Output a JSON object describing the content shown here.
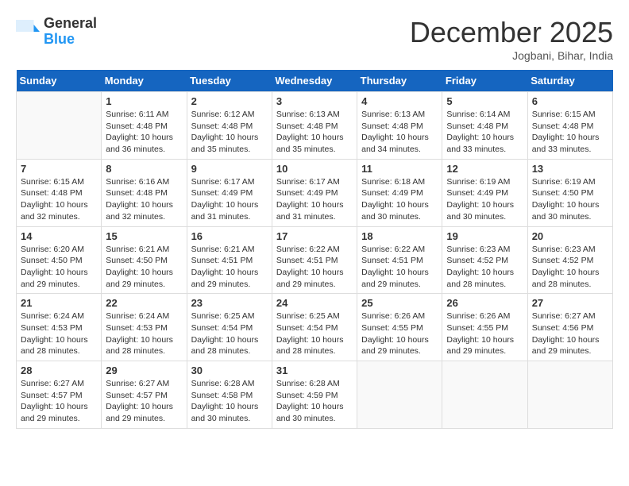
{
  "header": {
    "logo_general": "General",
    "logo_blue": "Blue",
    "month_title": "December 2025",
    "location": "Jogbani, Bihar, India"
  },
  "calendar": {
    "days_of_week": [
      "Sunday",
      "Monday",
      "Tuesday",
      "Wednesday",
      "Thursday",
      "Friday",
      "Saturday"
    ],
    "weeks": [
      [
        {
          "day": "",
          "info": ""
        },
        {
          "day": "1",
          "info": "Sunrise: 6:11 AM\nSunset: 4:48 PM\nDaylight: 10 hours and 36 minutes."
        },
        {
          "day": "2",
          "info": "Sunrise: 6:12 AM\nSunset: 4:48 PM\nDaylight: 10 hours and 35 minutes."
        },
        {
          "day": "3",
          "info": "Sunrise: 6:13 AM\nSunset: 4:48 PM\nDaylight: 10 hours and 35 minutes."
        },
        {
          "day": "4",
          "info": "Sunrise: 6:13 AM\nSunset: 4:48 PM\nDaylight: 10 hours and 34 minutes."
        },
        {
          "day": "5",
          "info": "Sunrise: 6:14 AM\nSunset: 4:48 PM\nDaylight: 10 hours and 33 minutes."
        },
        {
          "day": "6",
          "info": "Sunrise: 6:15 AM\nSunset: 4:48 PM\nDaylight: 10 hours and 33 minutes."
        }
      ],
      [
        {
          "day": "7",
          "info": "Sunrise: 6:15 AM\nSunset: 4:48 PM\nDaylight: 10 hours and 32 minutes."
        },
        {
          "day": "8",
          "info": "Sunrise: 6:16 AM\nSunset: 4:48 PM\nDaylight: 10 hours and 32 minutes."
        },
        {
          "day": "9",
          "info": "Sunrise: 6:17 AM\nSunset: 4:49 PM\nDaylight: 10 hours and 31 minutes."
        },
        {
          "day": "10",
          "info": "Sunrise: 6:17 AM\nSunset: 4:49 PM\nDaylight: 10 hours and 31 minutes."
        },
        {
          "day": "11",
          "info": "Sunrise: 6:18 AM\nSunset: 4:49 PM\nDaylight: 10 hours and 30 minutes."
        },
        {
          "day": "12",
          "info": "Sunrise: 6:19 AM\nSunset: 4:49 PM\nDaylight: 10 hours and 30 minutes."
        },
        {
          "day": "13",
          "info": "Sunrise: 6:19 AM\nSunset: 4:50 PM\nDaylight: 10 hours and 30 minutes."
        }
      ],
      [
        {
          "day": "14",
          "info": "Sunrise: 6:20 AM\nSunset: 4:50 PM\nDaylight: 10 hours and 29 minutes."
        },
        {
          "day": "15",
          "info": "Sunrise: 6:21 AM\nSunset: 4:50 PM\nDaylight: 10 hours and 29 minutes."
        },
        {
          "day": "16",
          "info": "Sunrise: 6:21 AM\nSunset: 4:51 PM\nDaylight: 10 hours and 29 minutes."
        },
        {
          "day": "17",
          "info": "Sunrise: 6:22 AM\nSunset: 4:51 PM\nDaylight: 10 hours and 29 minutes."
        },
        {
          "day": "18",
          "info": "Sunrise: 6:22 AM\nSunset: 4:51 PM\nDaylight: 10 hours and 29 minutes."
        },
        {
          "day": "19",
          "info": "Sunrise: 6:23 AM\nSunset: 4:52 PM\nDaylight: 10 hours and 28 minutes."
        },
        {
          "day": "20",
          "info": "Sunrise: 6:23 AM\nSunset: 4:52 PM\nDaylight: 10 hours and 28 minutes."
        }
      ],
      [
        {
          "day": "21",
          "info": "Sunrise: 6:24 AM\nSunset: 4:53 PM\nDaylight: 10 hours and 28 minutes."
        },
        {
          "day": "22",
          "info": "Sunrise: 6:24 AM\nSunset: 4:53 PM\nDaylight: 10 hours and 28 minutes."
        },
        {
          "day": "23",
          "info": "Sunrise: 6:25 AM\nSunset: 4:54 PM\nDaylight: 10 hours and 28 minutes."
        },
        {
          "day": "24",
          "info": "Sunrise: 6:25 AM\nSunset: 4:54 PM\nDaylight: 10 hours and 28 minutes."
        },
        {
          "day": "25",
          "info": "Sunrise: 6:26 AM\nSunset: 4:55 PM\nDaylight: 10 hours and 29 minutes."
        },
        {
          "day": "26",
          "info": "Sunrise: 6:26 AM\nSunset: 4:55 PM\nDaylight: 10 hours and 29 minutes."
        },
        {
          "day": "27",
          "info": "Sunrise: 6:27 AM\nSunset: 4:56 PM\nDaylight: 10 hours and 29 minutes."
        }
      ],
      [
        {
          "day": "28",
          "info": "Sunrise: 6:27 AM\nSunset: 4:57 PM\nDaylight: 10 hours and 29 minutes."
        },
        {
          "day": "29",
          "info": "Sunrise: 6:27 AM\nSunset: 4:57 PM\nDaylight: 10 hours and 29 minutes."
        },
        {
          "day": "30",
          "info": "Sunrise: 6:28 AM\nSunset: 4:58 PM\nDaylight: 10 hours and 30 minutes."
        },
        {
          "day": "31",
          "info": "Sunrise: 6:28 AM\nSunset: 4:59 PM\nDaylight: 10 hours and 30 minutes."
        },
        {
          "day": "",
          "info": ""
        },
        {
          "day": "",
          "info": ""
        },
        {
          "day": "",
          "info": ""
        }
      ]
    ]
  }
}
